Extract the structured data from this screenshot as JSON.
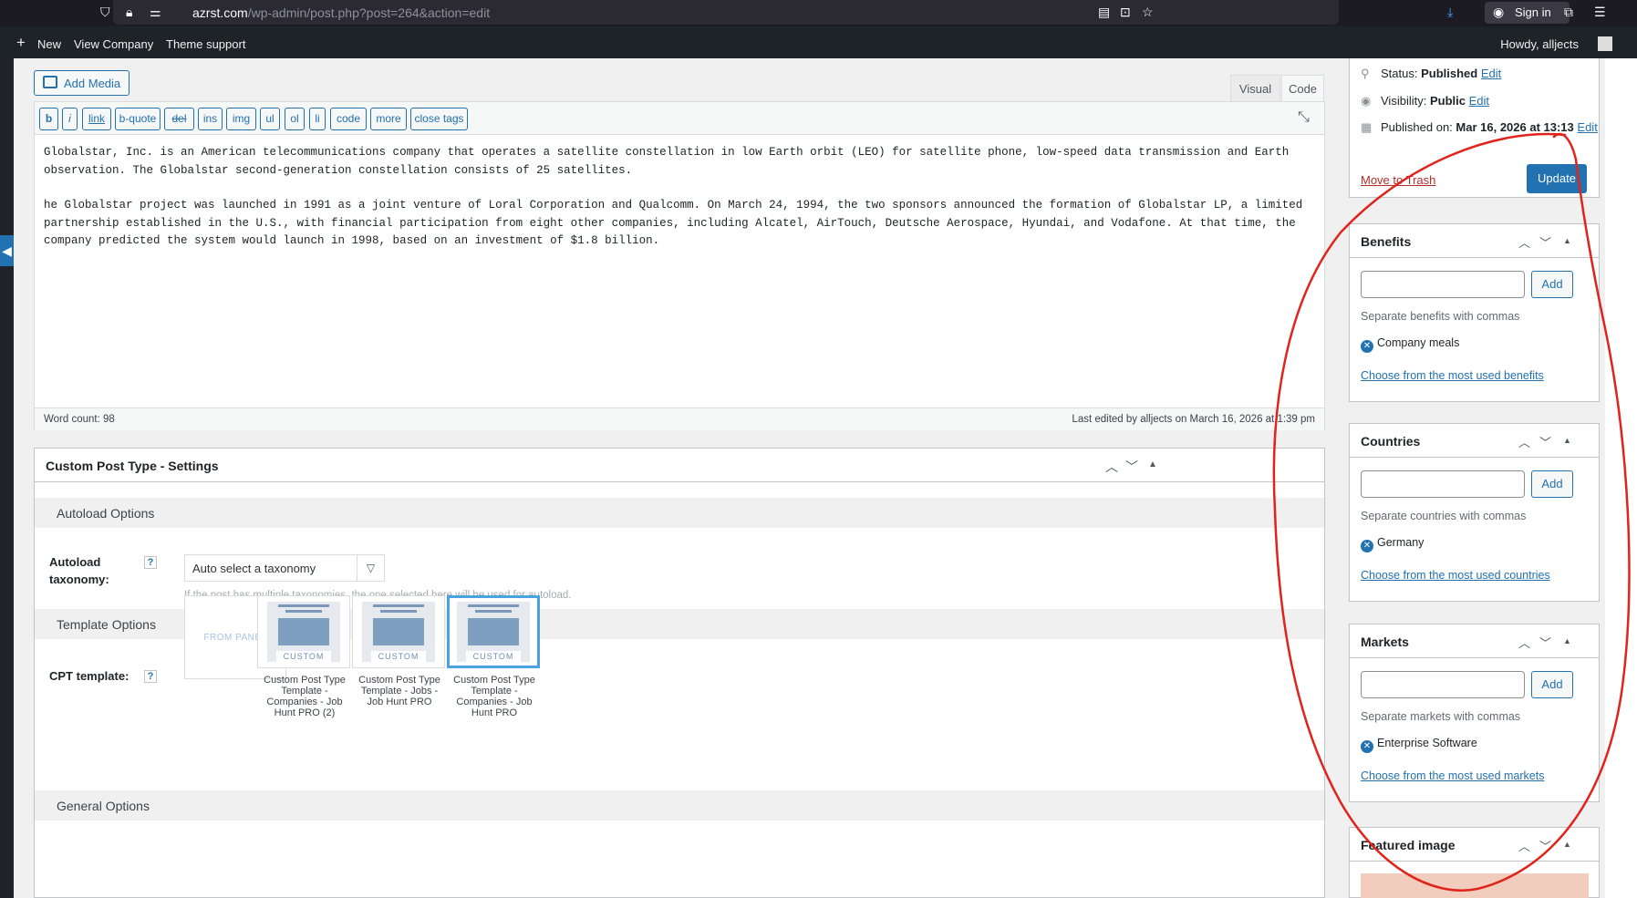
{
  "browser": {
    "url_host": "azrst.com",
    "url_path": "/wp-admin/post.php?post=264&action=edit",
    "sign_in_label": "Sign in"
  },
  "admin_bar": {
    "new_label": "New",
    "view_label": "View Company",
    "theme_label": "Theme support",
    "howdy": "Howdy, alljects"
  },
  "editor": {
    "add_media_label": "Add Media",
    "tab_visual": "Visual",
    "tab_code": "Code",
    "toolbar": [
      "b",
      "i",
      "link",
      "b-quote",
      "del",
      "ins",
      "img",
      "ul",
      "ol",
      "li",
      "code",
      "more",
      "close tags"
    ],
    "paragraphs": [
      "Globalstar, Inc. is an American telecommunications company that operates a satellite constellation in low Earth orbit (LEO) for satellite phone, low-speed data transmission and Earth observation. The Globalstar second-generation constellation consists of 25 satellites.",
      "he Globalstar project was launched in 1991 as a joint venture of Loral Corporation and Qualcomm. On March 24, 1994, the two sponsors announced the formation of Globalstar LP, a limited partnership established in the U.S., with financial participation from eight other companies, including Alcatel, AirTouch, Deutsche Aerospace, Hyundai, and Vodafone. At that time, the company predicted the system would launch in 1998, based on an investment of $1.8 billion."
    ],
    "word_count": "Word count: 98",
    "last_edited": "Last edited by alljects on March 16, 2026 at 1:39 pm"
  },
  "cpt_settings": {
    "title": "Custom Post Type - Settings",
    "autoload_section": "Autoload Options",
    "autoload_label": "Autoload taxonomy:",
    "help": "?",
    "taxonomy_value": "Auto select a taxonomy",
    "taxonomy_hint": "If the post has multiple taxonomies, the one selected here will be used for autoload.",
    "template_section": "Template Options",
    "template_label": "CPT template:",
    "from_panel": "FROM PANEL",
    "template_tag": "CUSTOM",
    "templates": [
      {
        "caption": "Custom Post Type Template - Companies - Job Hunt PRO (2)",
        "selected": false
      },
      {
        "caption": "Custom Post Type Template - Jobs - Job Hunt PRO",
        "selected": false
      },
      {
        "caption": "Custom Post Type Template - Companies - Job Hunt PRO",
        "selected": true
      }
    ],
    "general_section": "General Options"
  },
  "publish": {
    "status_label": "Status:",
    "status_value": "Published",
    "visibility_label": "Visibility:",
    "visibility_value": "Public",
    "published_label": "Published on:",
    "published_value": "Mar 16, 2026 at 13:13",
    "edit_label": "Edit",
    "trash_label": "Move to Trash",
    "update_label": "Update"
  },
  "taxonomies": [
    {
      "title": "Benefits",
      "hint": "Separate benefits with commas",
      "tag": "Company meals",
      "link": "Choose from the most used benefits",
      "add": "Add"
    },
    {
      "title": "Countries",
      "hint": "Separate countries with commas",
      "tag": "Germany",
      "link": "Choose from the most used countries",
      "add": "Add"
    },
    {
      "title": "Markets",
      "hint": "Separate markets with commas",
      "tag": "Enterprise Software",
      "link": "Choose from the most used markets",
      "add": "Add"
    }
  ],
  "featured": {
    "title": "Featured image"
  },
  "colors": {
    "accent": "#2271b1",
    "annotation": "#e0231b",
    "adminbar": "#1d2327"
  }
}
